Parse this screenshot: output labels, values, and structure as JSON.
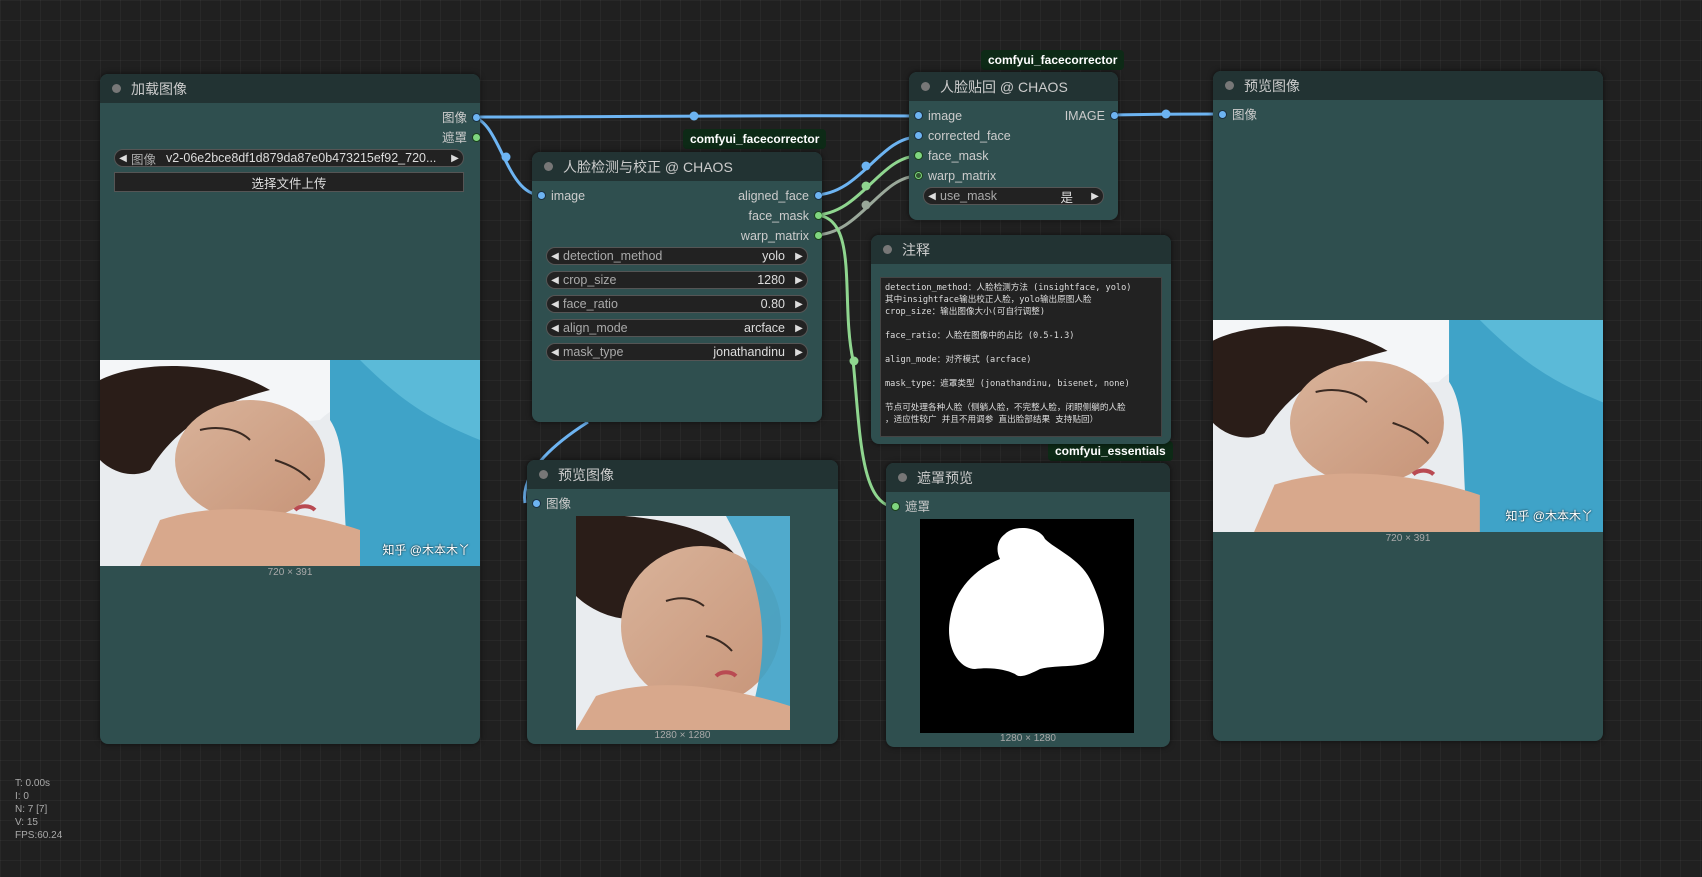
{
  "badges": {
    "facecorrector_1": "comfyui_facecorrector",
    "facecorrector_2": "comfyui_facecorrector",
    "essentials": "comfyui_essentials"
  },
  "load_image": {
    "title": "加载图像",
    "outputs": [
      "图像",
      "遮罩"
    ],
    "image_widget_label": "图像",
    "image_widget_value": "v2-06e2bce8df1d879da87e0b473215ef92_720...",
    "upload_button": "选择文件上传",
    "dims": "720 × 391",
    "watermark": "知乎 @木本木丫"
  },
  "detect_node": {
    "title": "人脸检测与校正 @ CHAOS",
    "input": "image",
    "outputs": [
      "aligned_face",
      "face_mask",
      "warp_matrix"
    ],
    "widgets": [
      {
        "label": "detection_method",
        "value": "yolo"
      },
      {
        "label": "crop_size",
        "value": "1280"
      },
      {
        "label": "face_ratio",
        "value": "0.80"
      },
      {
        "label": "align_mode",
        "value": "arcface"
      },
      {
        "label": "mask_type",
        "value": "jonathandinu"
      }
    ]
  },
  "paste_node": {
    "title": "人脸贴回 @ CHAOS",
    "inputs": [
      "image",
      "corrected_face",
      "face_mask",
      "warp_matrix"
    ],
    "output": "IMAGE",
    "widget": {
      "label": "use_mask",
      "value": "是"
    }
  },
  "note_node": {
    "title": "注释",
    "text": "detection_method：人脸检测方法 (insightface, yolo)\n其中insightface输出校正人脸，yolo输出原图人脸\ncrop_size：输出图像大小(可自行调整)\n\nface_ratio：人脸在图像中的占比 (0.5-1.3)\n\nalign_mode：对齐模式 (arcface)\n\nmask_type：遮罩类型 (jonathandinu, bisenet, none)\n\n节点可处理各种人脸（侧躺人脸，不完整人脸，闭眼侧躺的人脸\n，适应性较广 并且不用调参 直出脸部结果 支持贴回）"
  },
  "preview_mid": {
    "title": "预览图像",
    "input": "图像",
    "dims": "1280 × 1280"
  },
  "mask_preview": {
    "title": "遮罩预览",
    "input": "遮罩",
    "dims": "1280 × 1280"
  },
  "preview_right": {
    "title": "预览图像",
    "input": "图像",
    "dims": "720 × 391",
    "watermark": "知乎 @木本木丫"
  },
  "stats": [
    "T: 0.00s",
    "I: 0",
    "N: 7 [7]",
    "V: 15",
    "FPS:60.24"
  ],
  "colors": {
    "image_link": "#6db4f2",
    "mask_link": "#8fd68f",
    "matrix_link": "#9aa89a",
    "node_body": "#2f4f4f",
    "node_title": "#223333"
  }
}
